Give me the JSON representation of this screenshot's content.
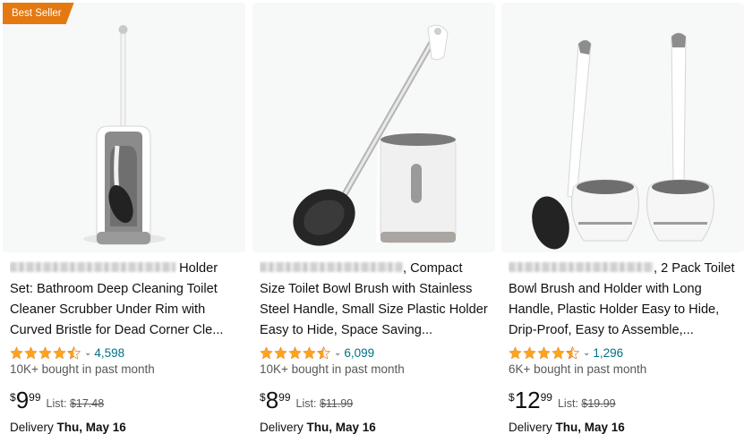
{
  "products": [
    {
      "badge": "Best Seller",
      "title_visible": "Holder Set: Bathroom Deep Cleaning Toilet Cleaner Scrubber Under Rim with Curved Bristle for Dead Corner Cle...",
      "rating_stars": 4.5,
      "review_count": "4,598",
      "bought": "10K+ bought in past month",
      "price_symbol": "$",
      "price_whole": "9",
      "price_fraction": "99",
      "list_label": "List:",
      "list_price": "$17.48",
      "delivery_label": "Delivery",
      "delivery_date": "Thu, May 16"
    },
    {
      "badge": "",
      "title_visible": ", Compact Size Toilet Bowl Brush with Stainless Steel Handle, Small Size Plastic Holder Easy to Hide, Space Saving...",
      "rating_stars": 4.5,
      "review_count": "6,099",
      "bought": "10K+ bought in past month",
      "price_symbol": "$",
      "price_whole": "8",
      "price_fraction": "99",
      "list_label": "List:",
      "list_price": "$11.99",
      "delivery_label": "Delivery",
      "delivery_date": "Thu, May 16"
    },
    {
      "badge": "",
      "title_visible": ", 2 Pack Toilet Bowl Brush and Holder with Long Handle, Plastic Holder Easy to Hide, Drip-Proof, Easy to Assemble,...",
      "rating_stars": 4.5,
      "review_count": "1,296",
      "bought": "6K+ bought in past month",
      "price_symbol": "$",
      "price_whole": "12",
      "price_fraction": "99",
      "list_label": "List:",
      "list_price": "$19.99",
      "delivery_label": "Delivery",
      "delivery_date": "Thu, May 16"
    }
  ],
  "colors": {
    "star": "#ffa41c",
    "link": "#007185",
    "badge": "#e47911"
  },
  "icons": {
    "star": "star-icon",
    "chevron": "chevron-down-icon"
  }
}
